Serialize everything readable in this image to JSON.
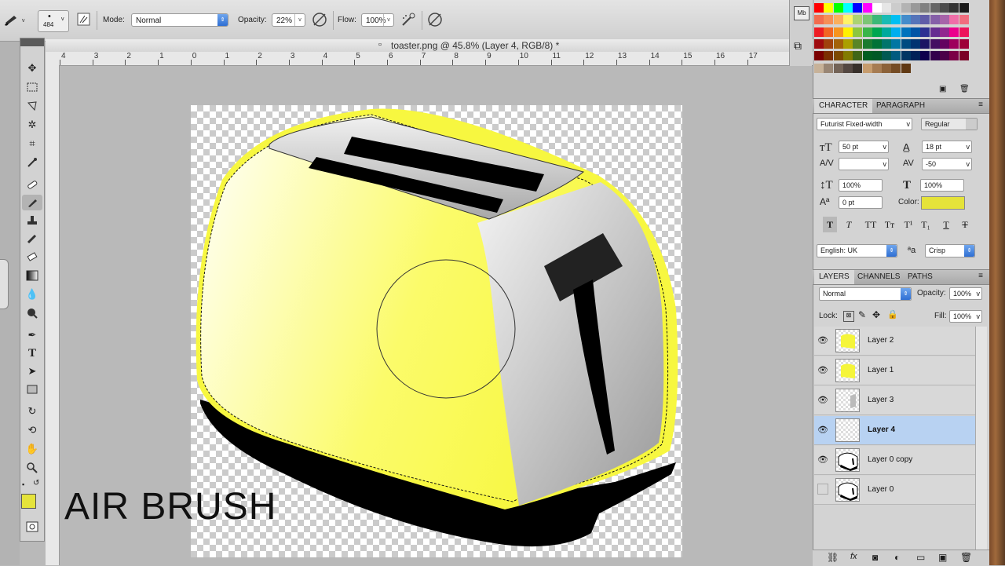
{
  "options": {
    "brush_size": "484",
    "mode_label": "Mode:",
    "mode_value": "Normal",
    "opacity_label": "Opacity:",
    "opacity_value": "22%",
    "flow_label": "Flow:",
    "flow_value": "100%"
  },
  "document": {
    "title": "toaster.png @ 45.8% (Layer 4, RGB/8) *"
  },
  "ruler": {
    "ticks": [
      "4",
      "3",
      "2",
      "1",
      "0",
      "1",
      "2",
      "3",
      "4",
      "5",
      "6",
      "7",
      "8",
      "9",
      "10",
      "11",
      "12",
      "13",
      "14",
      "15",
      "16",
      "17"
    ]
  },
  "canvas_text": "AIR BRUSH",
  "character_panel": {
    "tabs": [
      "CHARACTER",
      "PARAGRAPH"
    ],
    "font_family": "Futurist Fixed-width",
    "font_style": "Regular",
    "font_size": "50 pt",
    "leading": "18 pt",
    "kerning": "",
    "tracking": "-50",
    "vertical_scale": "100%",
    "horizontal_scale": "100%",
    "baseline_shift": "0 pt",
    "color_label": "Color:",
    "color_value": "#e5e33a",
    "language": "English: UK",
    "antialias": "Crisp"
  },
  "layers_panel": {
    "tabs": [
      "LAYERS",
      "CHANNELS",
      "PATHS"
    ],
    "blend_mode": "Normal",
    "opacity_label": "Opacity:",
    "opacity_value": "100%",
    "lock_label": "Lock:",
    "fill_label": "Fill:",
    "fill_value": "100%",
    "layers": [
      {
        "name": "Layer 2",
        "visible": true,
        "selected": false
      },
      {
        "name": "Layer 1",
        "visible": true,
        "selected": false
      },
      {
        "name": "Layer 3",
        "visible": true,
        "selected": false
      },
      {
        "name": "Layer 4",
        "visible": true,
        "selected": true
      },
      {
        "name": "Layer 0 copy",
        "visible": true,
        "selected": false
      },
      {
        "name": "Layer 0",
        "visible": false,
        "selected": false
      }
    ]
  },
  "colors": {
    "foreground": "#e5e33a",
    "background": "#ffffff",
    "selection": "#b8d2f2"
  }
}
